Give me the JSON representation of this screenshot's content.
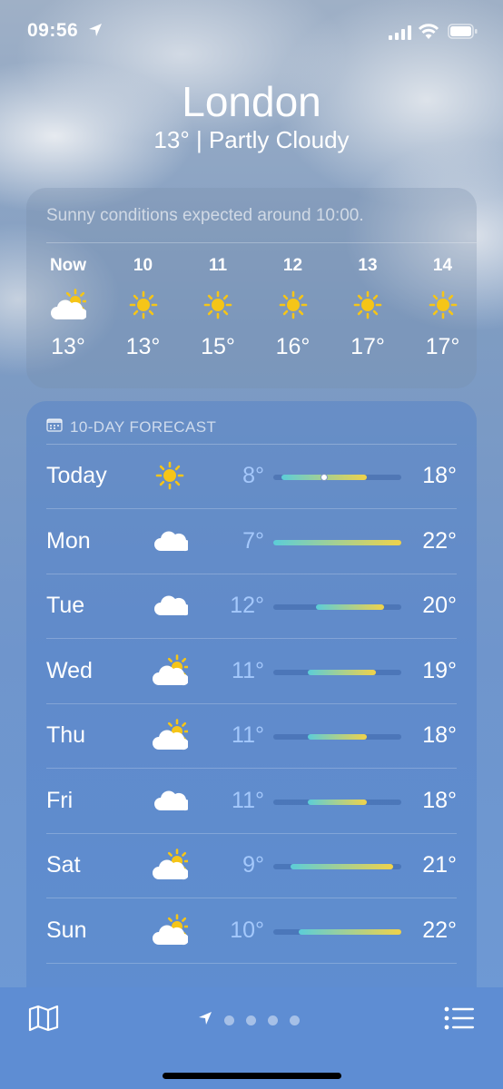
{
  "status_bar": {
    "time": "09:56"
  },
  "header": {
    "city": "London",
    "condition": "13°  |  Partly Cloudy"
  },
  "hourly": {
    "summary": "Sunny conditions expected around 10:00.",
    "hours": [
      {
        "label": "Now",
        "icon": "partly-cloudy-icon",
        "temp": "13°"
      },
      {
        "label": "10",
        "icon": "sun-icon",
        "temp": "13°"
      },
      {
        "label": "11",
        "icon": "sun-icon",
        "temp": "15°"
      },
      {
        "label": "12",
        "icon": "sun-icon",
        "temp": "16°"
      },
      {
        "label": "13",
        "icon": "sun-icon",
        "temp": "17°"
      },
      {
        "label": "14",
        "icon": "sun-icon",
        "temp": "17°"
      }
    ]
  },
  "forecast": {
    "title": "10-DAY FORECAST",
    "scale_min": 7,
    "scale_max": 22,
    "days": [
      {
        "day": "Today",
        "icon": "sun-icon",
        "low": "8°",
        "high": "18°",
        "low_value": 8,
        "high_value": 18,
        "current_value": 13
      },
      {
        "day": "Mon",
        "icon": "cloud-icon",
        "low": "7°",
        "high": "22°",
        "low_value": 7,
        "high_value": 22
      },
      {
        "day": "Tue",
        "icon": "cloud-icon",
        "low": "12°",
        "high": "20°",
        "low_value": 12,
        "high_value": 20
      },
      {
        "day": "Wed",
        "icon": "partly-cloudy-icon",
        "low": "11°",
        "high": "19°",
        "low_value": 11,
        "high_value": 19
      },
      {
        "day": "Thu",
        "icon": "partly-cloudy-icon",
        "low": "11°",
        "high": "18°",
        "low_value": 11,
        "high_value": 18
      },
      {
        "day": "Fri",
        "icon": "cloud-icon",
        "low": "11°",
        "high": "18°",
        "low_value": 11,
        "high_value": 18
      },
      {
        "day": "Sat",
        "icon": "partly-cloudy-icon",
        "low": "9°",
        "high": "21°",
        "low_value": 9,
        "high_value": 21
      },
      {
        "day": "Sun",
        "icon": "partly-cloudy-icon",
        "low": "10°",
        "high": "22°",
        "low_value": 10,
        "high_value": 22
      }
    ]
  },
  "tab_bar": {
    "page_count": 4,
    "current_page": "location"
  },
  "colors": {
    "bar_cool": "#5ccdd8",
    "bar_mid": "#a8d46c",
    "bar_warm": "#f0d24a",
    "sun": "#f5c518"
  }
}
